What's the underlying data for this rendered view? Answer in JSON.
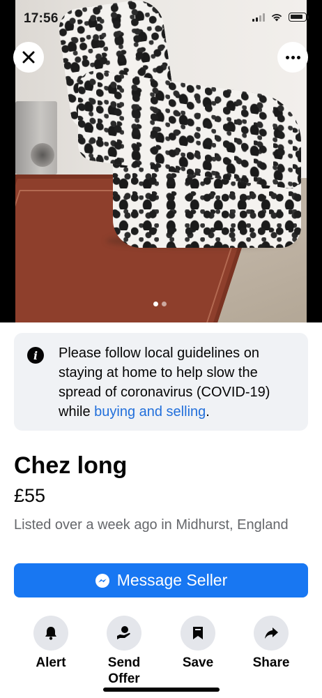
{
  "status_bar": {
    "time": "17:56"
  },
  "gallery": {
    "image_count": 2,
    "active_index": 0
  },
  "notice": {
    "text": "Please follow local guidelines on staying at home to help slow the spread of coronavirus (COVID-19) while ",
    "link": "buying and selling",
    "suffix": "."
  },
  "listing": {
    "title": "Chez long",
    "price": "£55",
    "location": "Listed over a week ago in Midhurst, England"
  },
  "message_button": {
    "label": "Message Seller",
    "color": "#1877f2"
  },
  "actions": [
    {
      "label": "Alert",
      "icon": "bell-icon"
    },
    {
      "label": "Send Offer",
      "icon": "send-offer-icon"
    },
    {
      "label": "Save",
      "icon": "bookmark-icon"
    },
    {
      "label": "Share",
      "icon": "share-arrow-icon"
    }
  ]
}
